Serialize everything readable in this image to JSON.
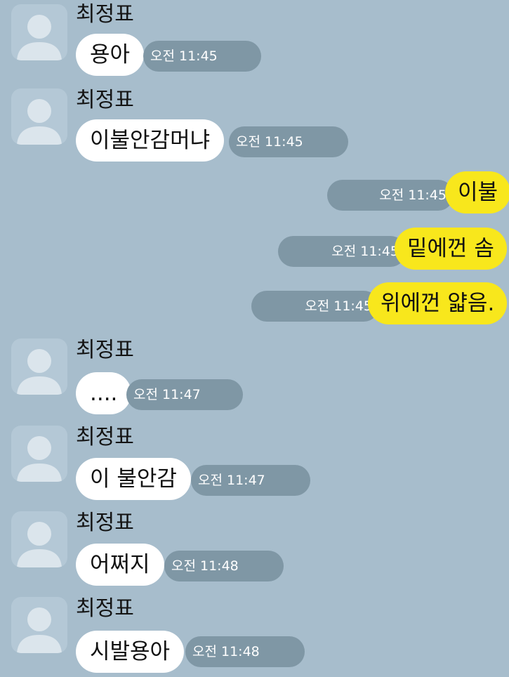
{
  "conversation": {
    "sender_name": "최정표",
    "messages": [
      {
        "from": "other",
        "text": "용아",
        "time": "오전 11:45"
      },
      {
        "from": "other",
        "text": "이불안감머냐",
        "time": "오전 11:45"
      },
      {
        "from": "me",
        "text": "이불",
        "time": "오전 11:45"
      },
      {
        "from": "me",
        "text": "밑에껀 솜",
        "time": "오전 11:45"
      },
      {
        "from": "me",
        "text": "위에껀 얇음.",
        "time": "오전 11:45"
      },
      {
        "from": "other",
        "text": "....",
        "time": "오전 11:47"
      },
      {
        "from": "other",
        "text": "이 불안감",
        "time": "오전 11:47"
      },
      {
        "from": "other",
        "text": "어쩌지",
        "time": "오전 11:48"
      },
      {
        "from": "other",
        "text": "시발용아",
        "time": "오전 11:48"
      }
    ]
  },
  "colors": {
    "background": "#a7bdcc",
    "incoming_bubble": "#ffffff",
    "outgoing_bubble": "#f8e71c",
    "time_pill": "#7f97a5"
  },
  "icons": {
    "avatar": "default-person-avatar-icon"
  }
}
